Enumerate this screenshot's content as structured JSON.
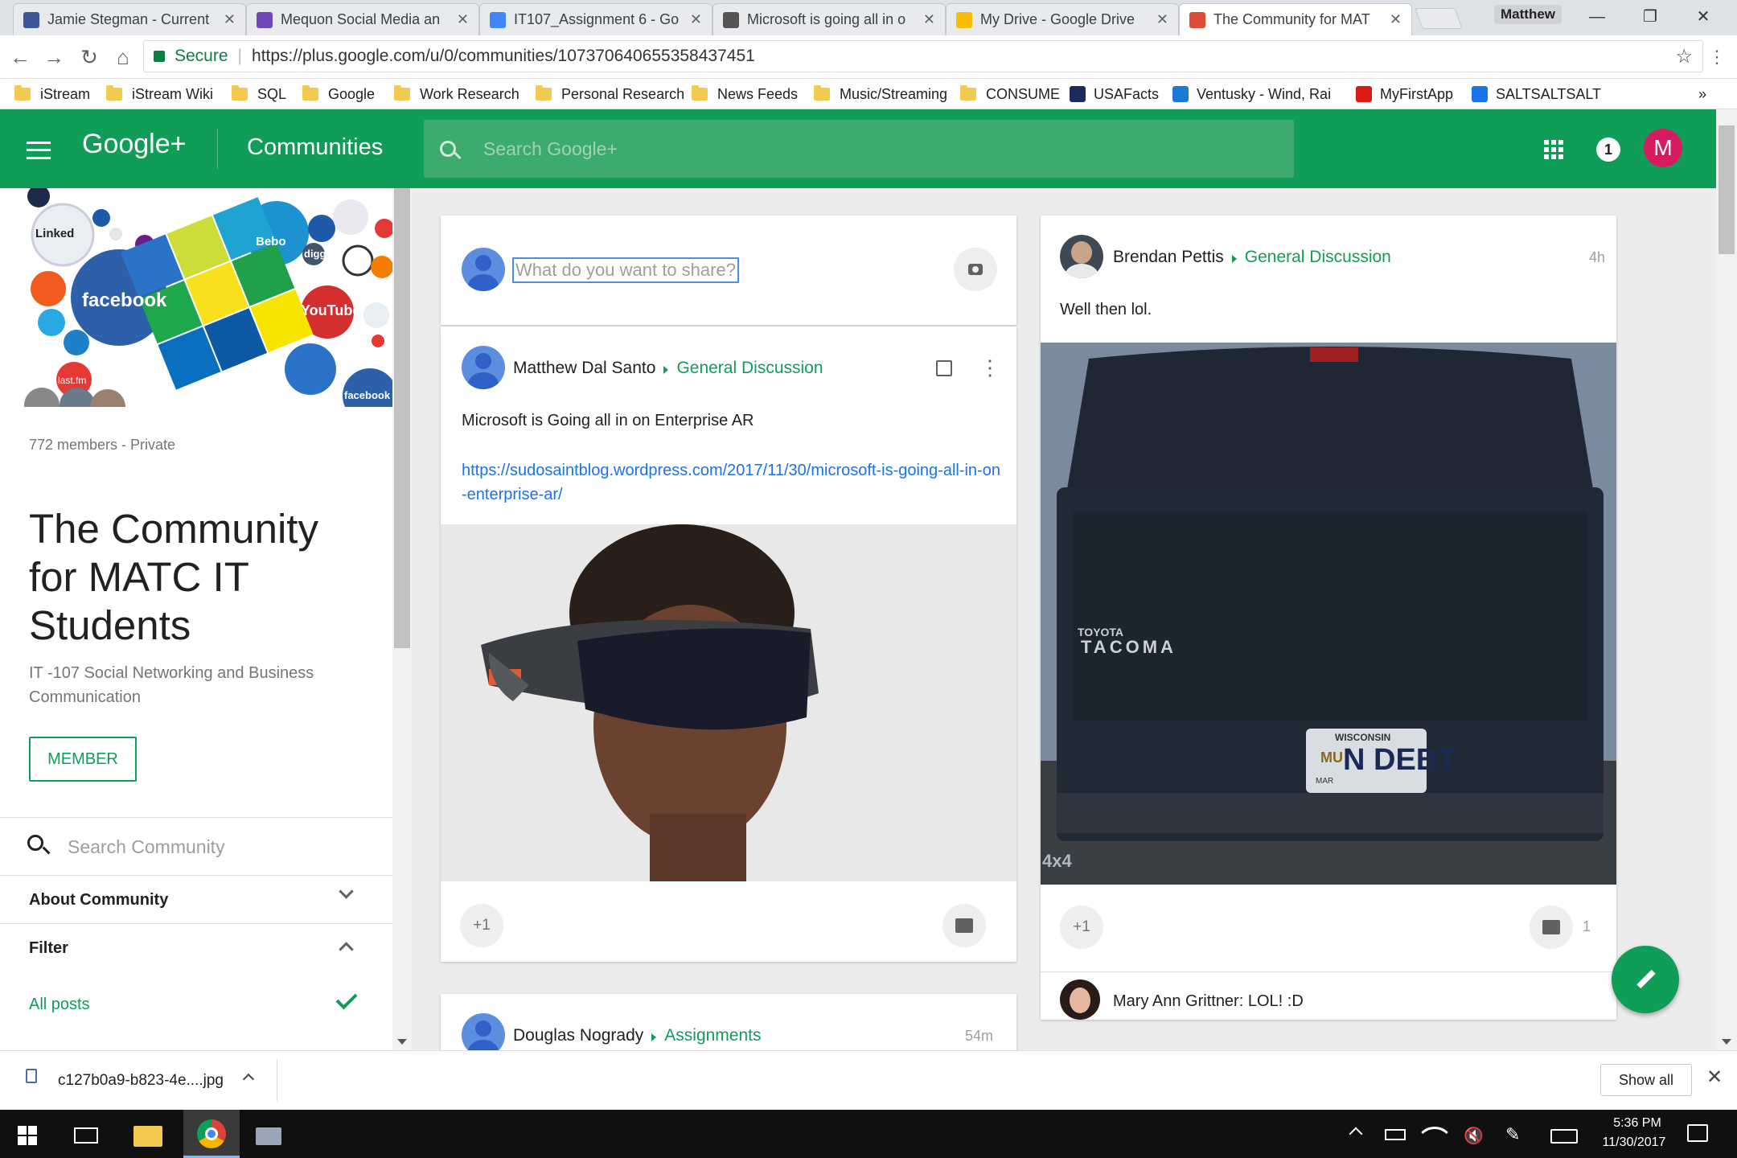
{
  "browser": {
    "tabs": [
      {
        "title": "Jamie Stegman - Current",
        "favicon_color": "#3b5998",
        "favicon": "facebook-icon"
      },
      {
        "title": "Mequon Social Media an",
        "favicon_color": "#6e49b7",
        "favicon": "community-icon"
      },
      {
        "title": "IT107_Assignment 6 - Go",
        "favicon_color": "#4285f4",
        "favicon": "docs-icon"
      },
      {
        "title": "Microsoft is going all in o",
        "favicon_color": "#555555",
        "favicon": "blog-icon"
      },
      {
        "title": "My Drive - Google Drive",
        "favicon_color": "#fbbc05",
        "favicon": "drive-icon"
      },
      {
        "title": "The Community for MAT",
        "favicon_color": "#dd4b39",
        "favicon": "google-plus-icon",
        "active": true
      }
    ],
    "user_badge": "Matthew",
    "secure_label": "Secure",
    "url": "https://plus.google.com/u/0/communities/107370640655358437451",
    "bookmarks": [
      {
        "label": "iStream",
        "type": "folder"
      },
      {
        "label": "iStream Wiki",
        "type": "folder"
      },
      {
        "label": "SQL",
        "type": "folder"
      },
      {
        "label": "Google",
        "type": "folder"
      },
      {
        "label": "Work Research",
        "type": "folder"
      },
      {
        "label": "Personal Research",
        "type": "folder"
      },
      {
        "label": "News Feeds",
        "type": "folder"
      },
      {
        "label": "Music/Streaming",
        "type": "folder"
      },
      {
        "label": "CONSUME",
        "type": "folder"
      },
      {
        "label": "USAFacts",
        "type": "site",
        "color": "#1d2a5e"
      },
      {
        "label": "Ventusky - Wind, Rai",
        "type": "site",
        "color": "#1c7ad6"
      },
      {
        "label": "MyFirstApp",
        "type": "site",
        "color": "#dd1b16"
      },
      {
        "label": "SALTSALTSALT",
        "type": "site",
        "color": "#1a73e8"
      }
    ],
    "more_bookmarks": "»"
  },
  "gplus": {
    "logo": "Google+",
    "section": "Communities",
    "search_placeholder": "Search Google+",
    "notification_count": "1",
    "user_initial": "M",
    "accent": "#0f9d58"
  },
  "community": {
    "members": "772 members - Private",
    "title": "The Community for MATC IT Students",
    "subtitle": "IT -107 Social Networking and Business Communication",
    "member_button": "MEMBER",
    "search_placeholder": "Search Community",
    "about_label": "About Community",
    "filter_label": "Filter",
    "all_posts_label": "All posts",
    "banner_words": {
      "linkedin": "Linked",
      "facebook": "facebook",
      "youtube": "YouTube",
      "digg": "digg",
      "lastfm": "last.fm",
      "bebo": "Bebo"
    }
  },
  "share_box": {
    "placeholder": "What do you want to share?"
  },
  "posts": [
    {
      "author": "Matthew Dal Santo",
      "category": "General Discussion",
      "text": "Microsoft is Going all in on Enterprise AR",
      "link": "https://sudosaintblog.wordpress.com/2017/11/30/microsoft-is-going-all-in-on-enterprise-ar/",
      "plus_one": "+1"
    },
    {
      "author": "Brendan Pettis",
      "category": "General Discussion",
      "time": "4h",
      "text": "Well then lol.",
      "plus_one": "+1",
      "comment_count": "1",
      "comment_author": "Mary Ann Grittner:",
      "comment_text": "LOL! :D",
      "photo_text": {
        "make": "TOYOTA",
        "model": "TACOMA",
        "plate_state": "WISCONSIN",
        "plate": "N DEBT",
        "plate_left": "MU",
        "plate_bottom": "MAR",
        "badge": "4x4"
      }
    },
    {
      "author": "Douglas Nogrady",
      "category": "Assignments",
      "time": "54m"
    }
  ],
  "download": {
    "filename": "c127b0a9-b823-4e....jpg",
    "show_all": "Show all"
  },
  "taskbar": {
    "time": "5:36 PM",
    "date": "11/30/2017"
  }
}
